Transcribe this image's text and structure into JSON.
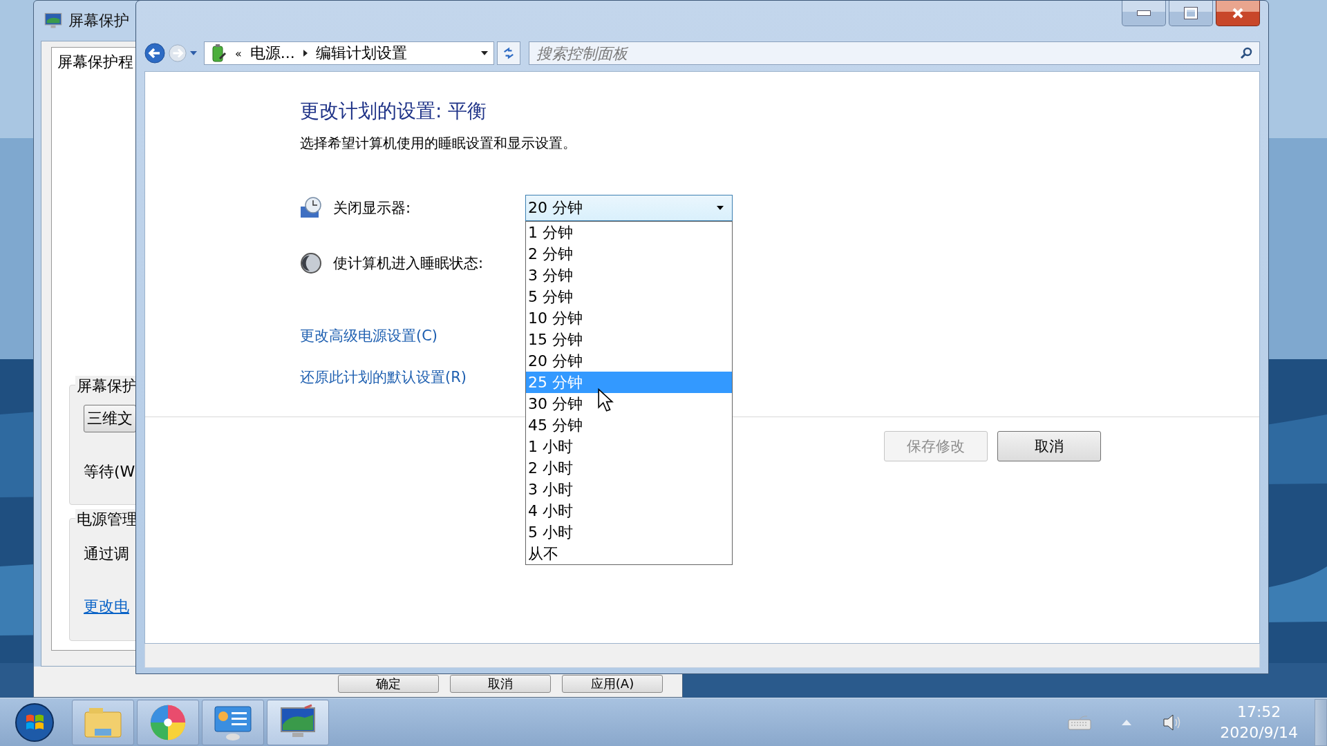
{
  "background_window": {
    "title": "屏幕保护",
    "preview_text": "屏幕保护程",
    "screensaver_group": {
      "title": "屏幕保护",
      "button": "三维文",
      "wait_label": "等待(W"
    },
    "power_group": {
      "title": "电源管理",
      "text": "通过调",
      "link": "更改电"
    },
    "buttons": [
      "确定",
      "取消",
      "应用(A)"
    ]
  },
  "address_bar": {
    "overflow": "«",
    "crumbs": [
      "电源...",
      "编辑计划设置"
    ]
  },
  "search": {
    "placeholder": "搜索控制面板"
  },
  "heading": "更改计划的设置: 平衡",
  "subtitle": "选择希望计算机使用的睡眠设置和显示设置。",
  "settings": [
    {
      "kind": "display",
      "label": "关闭显示器:",
      "value": "20 分钟",
      "expanded": true
    },
    {
      "kind": "sleep",
      "label": "使计算机进入睡眠状态:"
    }
  ],
  "dropdown_options": [
    {
      "label": "1 分钟",
      "selected": false
    },
    {
      "label": "2 分钟",
      "selected": false
    },
    {
      "label": "3 分钟",
      "selected": false
    },
    {
      "label": "5 分钟",
      "selected": false
    },
    {
      "label": "10 分钟",
      "selected": false
    },
    {
      "label": "15 分钟",
      "selected": false
    },
    {
      "label": "20 分钟",
      "selected": false
    },
    {
      "label": "25 分钟",
      "selected": true
    },
    {
      "label": "30 分钟",
      "selected": false
    },
    {
      "label": "45 分钟",
      "selected": false
    },
    {
      "label": "1 小时",
      "selected": false
    },
    {
      "label": "2 小时",
      "selected": false
    },
    {
      "label": "3 小时",
      "selected": false
    },
    {
      "label": "4 小时",
      "selected": false
    },
    {
      "label": "5 小时",
      "selected": false
    },
    {
      "label": "从不",
      "selected": false
    }
  ],
  "links": [
    "更改高级电源设置(C)",
    "还原此计划的默认设置(R)"
  ],
  "buttons": [
    {
      "label": "保存修改",
      "disabled": true
    },
    {
      "label": "取消",
      "disabled": false
    }
  ],
  "clock": {
    "time": "17:52",
    "date": "2020/9/14"
  }
}
